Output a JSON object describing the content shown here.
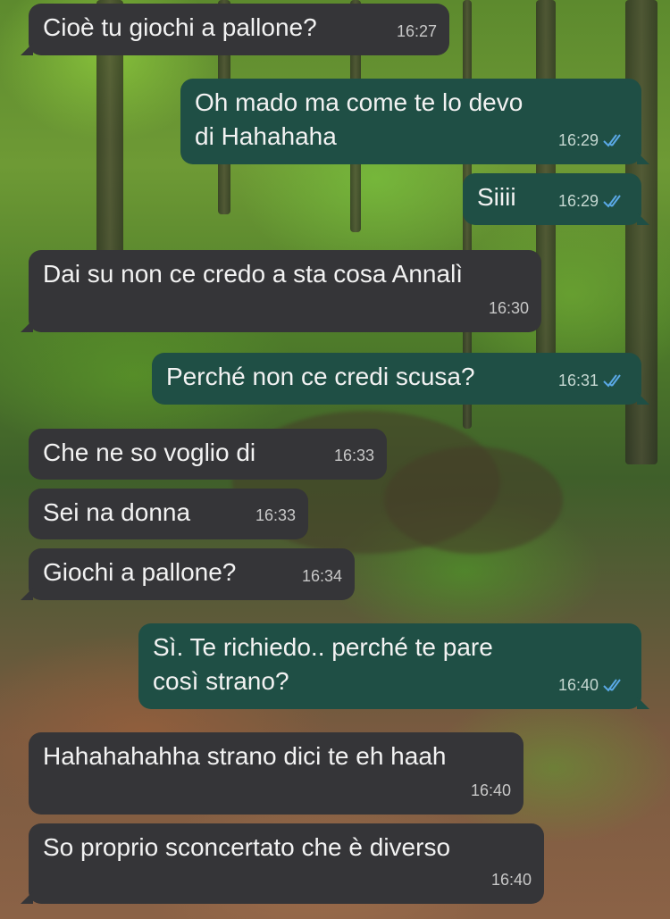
{
  "chat": {
    "messages": [
      {
        "direction": "in",
        "text": "Cioè tu giochi a pallone?",
        "time": "16:27"
      },
      {
        "direction": "out",
        "text": "Oh mado ma come te lo devo\ndi Hahahaha",
        "time": "16:29",
        "status": "read"
      },
      {
        "direction": "out",
        "text": "Siiii",
        "time": "16:29",
        "status": "read"
      },
      {
        "direction": "in",
        "text": "Dai su non ce credo a sta cosa Annalì",
        "time": "16:30"
      },
      {
        "direction": "out",
        "text": "Perché non ce credi scusa?",
        "time": "16:31",
        "status": "read"
      },
      {
        "direction": "in",
        "text": "Che ne so voglio di",
        "time": "16:33"
      },
      {
        "direction": "in",
        "text": "Sei na donna",
        "time": "16:33"
      },
      {
        "direction": "in",
        "text": "Giochi a pallone?",
        "time": "16:34"
      },
      {
        "direction": "out",
        "text": "Sì. Te richiedo.. perché te pare\ncosì strano?",
        "time": "16:40",
        "status": "read"
      },
      {
        "direction": "in",
        "text": "Hahahahahha strano dici te eh haah",
        "time": "16:40"
      },
      {
        "direction": "in",
        "text": "So proprio sconcertato che è diverso",
        "time": "16:40"
      }
    ]
  },
  "colors": {
    "incoming_bubble": "#353538",
    "outgoing_bubble": "#1f4f45",
    "read_ticks": "#5aa9e6"
  },
  "icons": {
    "read_status": "double-check-icon"
  }
}
